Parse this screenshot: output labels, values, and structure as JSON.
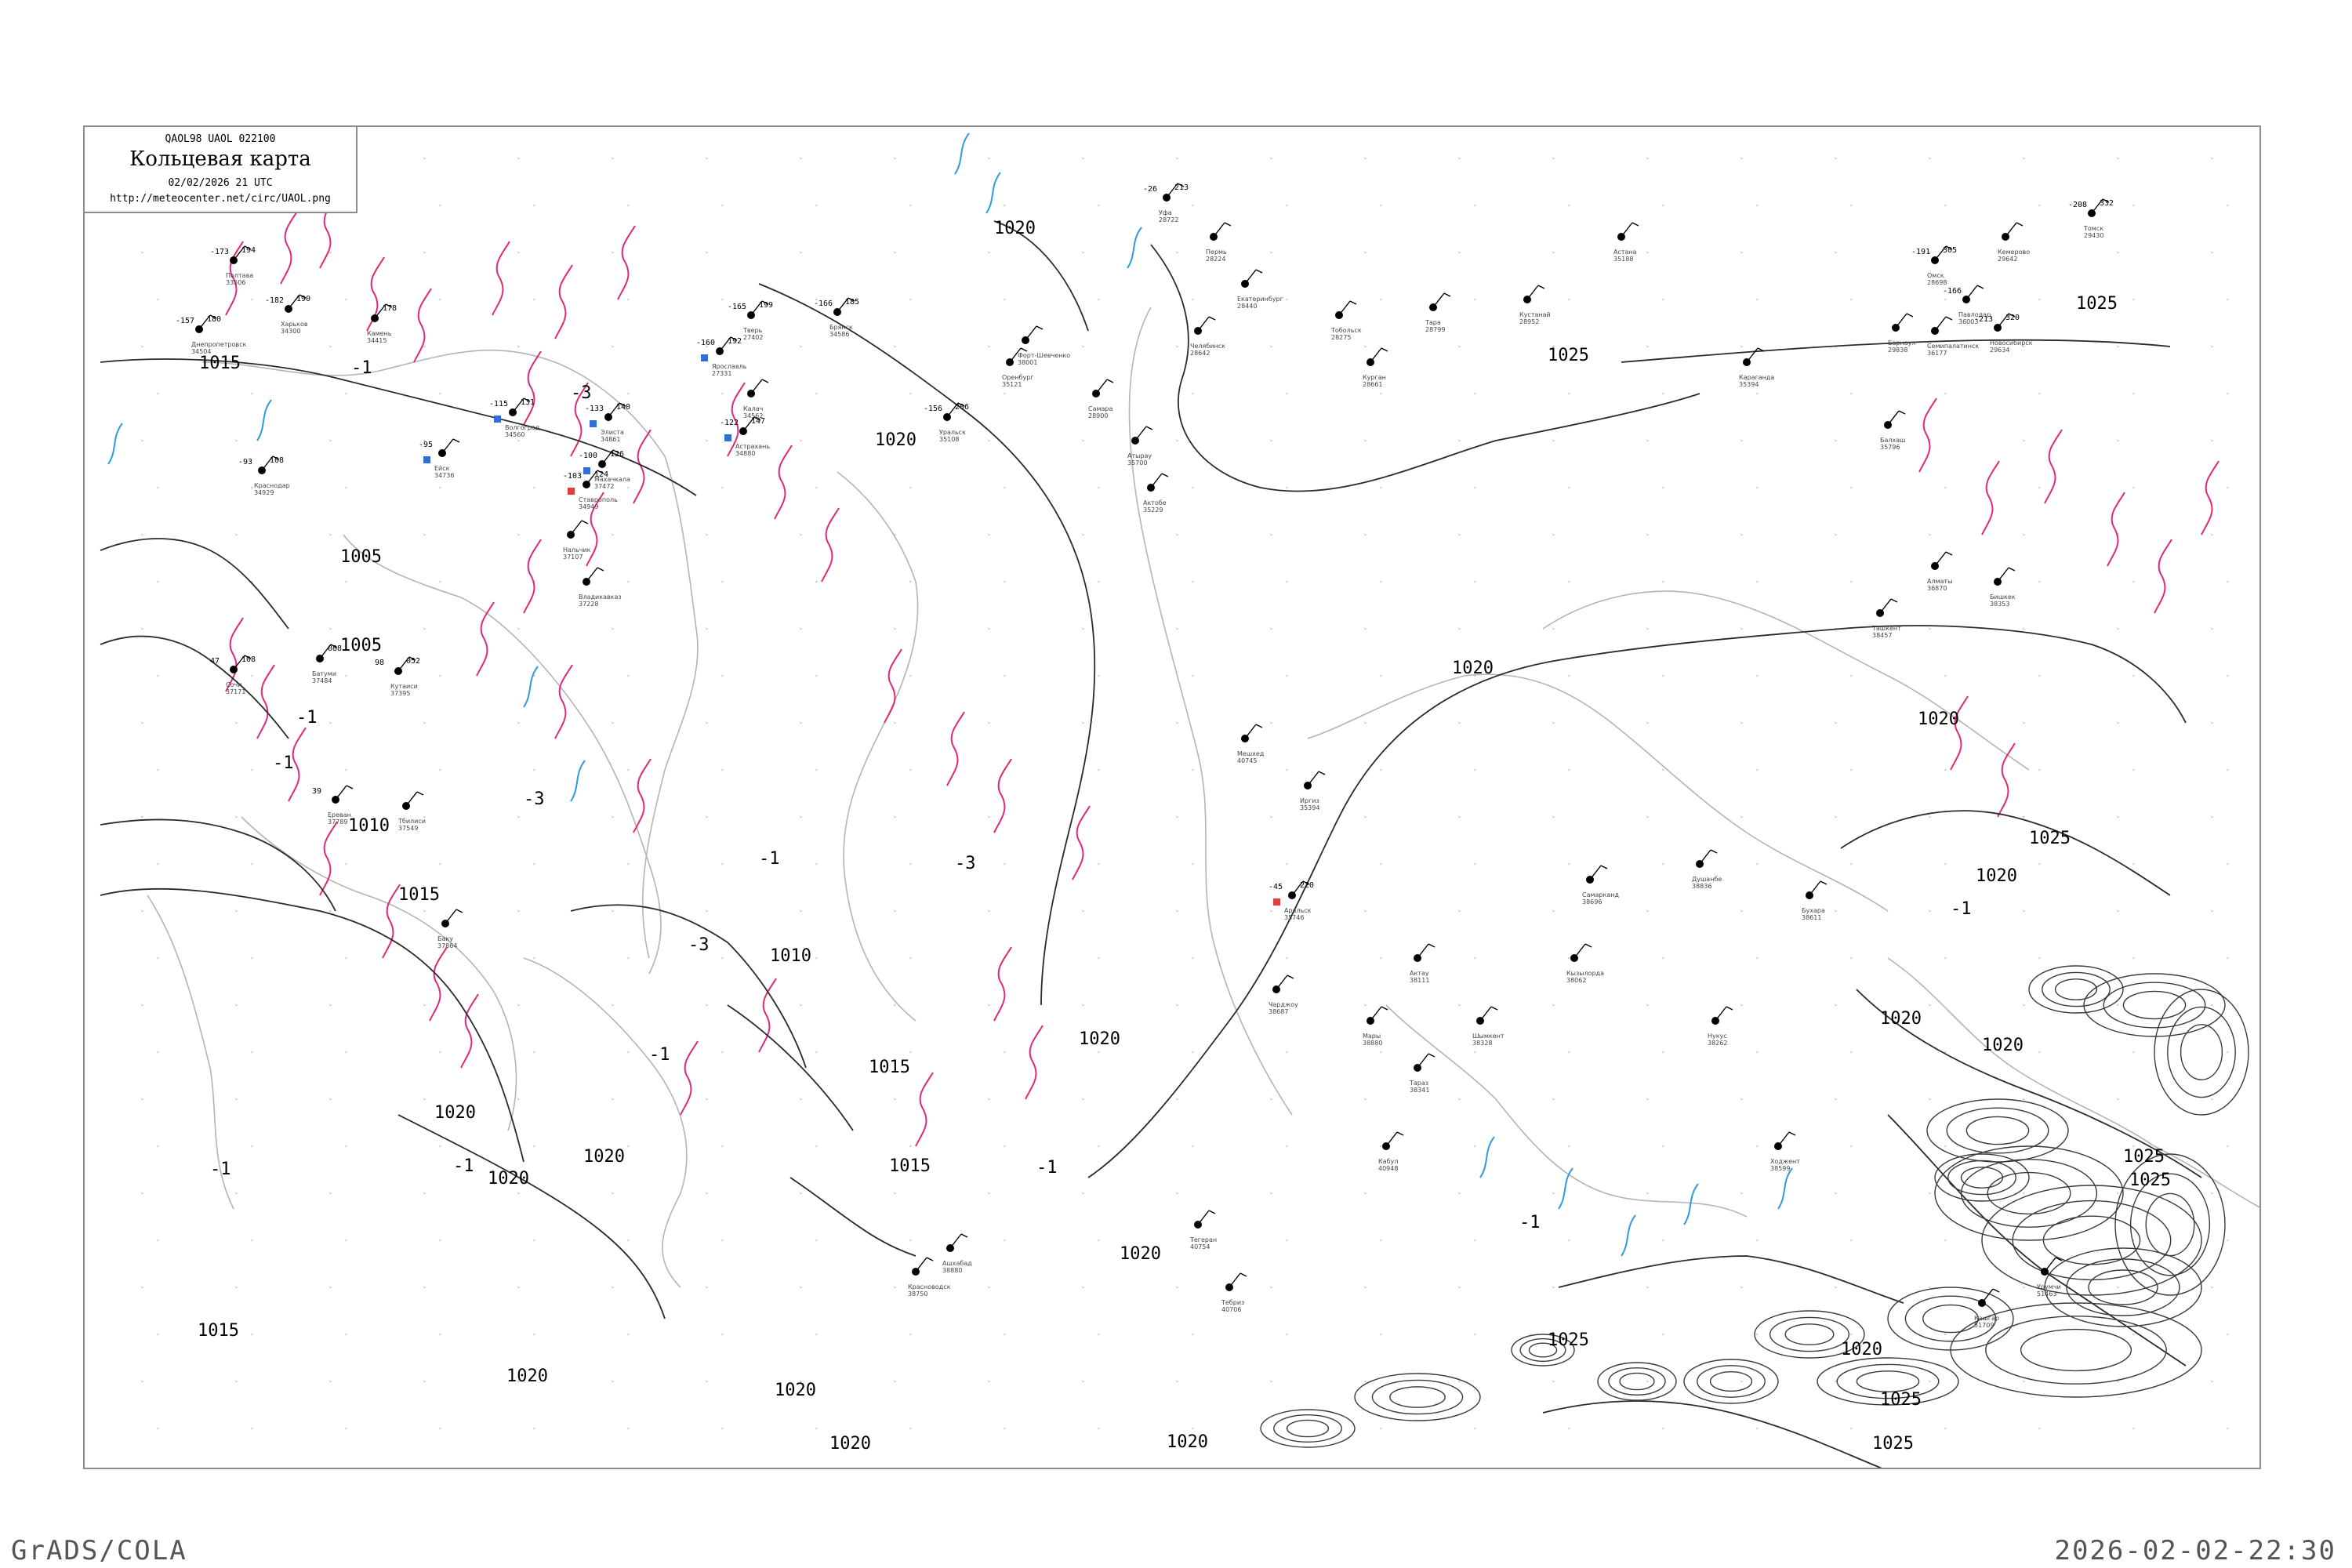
{
  "legend": {
    "code_line": "QAOL98  UAOL  022100",
    "title": "Кольцевая карта",
    "datetime": "02/02/2026 21 UTC",
    "url": "http://meteocenter.net/circ/UAOL.png"
  },
  "footer": {
    "left": "GrADS/COLA",
    "right": "2026-02-02-22:30"
  },
  "colors": {
    "coast": "#b4b4b4",
    "isobar": "#2a2a2a",
    "isotherm_neg": "#e0287a",
    "isotherm_pos": "#2d9be0",
    "marker_blue": "#2f6fd8",
    "marker_green": "#21a83a",
    "marker_red": "#e0403a",
    "marker_yellow": "#f0d22a"
  },
  "isobar_labels": [
    "1015",
    "1005",
    "1005",
    "1010",
    "1015",
    "1010",
    "1015",
    "1020",
    "1020",
    "1020",
    "1020",
    "1020",
    "1020",
    "1015",
    "1020",
    "1020",
    "1020",
    "1020",
    "1020",
    "1025",
    "1025",
    "1020",
    "1025",
    "1020",
    "1025",
    "1025",
    "1025",
    "1020",
    "1015",
    "1020",
    "1025",
    "1020",
    "1025",
    "1020"
  ],
  "isotherm_labels": [
    "-1",
    "-3",
    "-1",
    "-1",
    "-3",
    "-3",
    "-1",
    "-3",
    "-1",
    "-1",
    "-1",
    "-1",
    "-1",
    "-1"
  ],
  "stations": [
    {
      "name": "Полтава",
      "id": "33506",
      "t": "-173",
      "p": "194",
      "m": "none"
    },
    {
      "name": "Днепропетровск",
      "id": "34504",
      "t": "-157",
      "p": "180",
      "m": "none"
    },
    {
      "name": "Харьков",
      "id": "34300",
      "t": "-182",
      "p": "190",
      "m": "none"
    },
    {
      "name": "Камень",
      "id": "34415",
      "t": "",
      "p": "178",
      "m": "none"
    },
    {
      "name": "Тверь",
      "id": "27402",
      "t": "-165",
      "p": "199",
      "m": "none"
    },
    {
      "name": "Ярославль",
      "id": "27331",
      "t": "-160",
      "p": "192",
      "m": "blue"
    },
    {
      "name": "Калач",
      "id": "34562",
      "t": "",
      "p": "",
      "m": "none"
    },
    {
      "name": "Брянск",
      "id": "34586",
      "t": "-166",
      "p": "185",
      "m": "none"
    },
    {
      "name": "Ейск",
      "id": "34736",
      "t": "-95",
      "p": "",
      "m": "blue"
    },
    {
      "name": "Элиста",
      "id": "34861",
      "t": "-133",
      "p": "140",
      "m": "blue"
    },
    {
      "name": "Волгоград",
      "id": "34560",
      "t": "-115",
      "p": "131",
      "m": "blue"
    },
    {
      "name": "Астрахань",
      "id": "34880",
      "t": "-122",
      "p": "147",
      "m": "blue"
    },
    {
      "name": "Махачкала",
      "id": "37472",
      "t": "-100",
      "p": "126",
      "m": "blue"
    },
    {
      "name": "Ставрополь",
      "id": "34949",
      "t": "-103",
      "p": "124",
      "m": "red"
    },
    {
      "name": "Нальчик",
      "id": "37107",
      "t": "",
      "p": "",
      "m": "none"
    },
    {
      "name": "Владикавказ",
      "id": "37228",
      "t": "",
      "p": "",
      "m": "none"
    },
    {
      "name": "Краснодар",
      "id": "34929",
      "t": "-93",
      "p": "108",
      "m": "none"
    },
    {
      "name": "Сочи",
      "id": "37171",
      "t": "47",
      "p": "108",
      "m": "none"
    },
    {
      "name": "Батуми",
      "id": "37484",
      "t": "",
      "p": "088",
      "m": "none"
    },
    {
      "name": "Кутаиси",
      "id": "37395",
      "t": "98",
      "p": "052",
      "m": "none"
    },
    {
      "name": "Тбилиси",
      "id": "37549",
      "t": "",
      "p": "",
      "m": "none"
    },
    {
      "name": "Ереван",
      "id": "37789",
      "t": "39",
      "p": "",
      "m": "none"
    },
    {
      "name": "Баку",
      "id": "37864",
      "t": "",
      "p": "",
      "m": "none"
    },
    {
      "name": "Ашхабад",
      "id": "38880",
      "t": "",
      "p": "",
      "m": "none"
    },
    {
      "name": "Красноводск",
      "id": "38750",
      "t": "",
      "p": "",
      "m": "none"
    },
    {
      "name": "Форт-Шевченко",
      "id": "38001",
      "t": "",
      "p": "",
      "m": "none"
    },
    {
      "name": "Оренбург",
      "id": "35121",
      "t": "",
      "p": "",
      "m": "none"
    },
    {
      "name": "Уральск",
      "id": "35108",
      "t": "-156",
      "p": "206",
      "m": "none"
    },
    {
      "name": "Самара",
      "id": "28900",
      "t": "",
      "p": "",
      "m": "none"
    },
    {
      "name": "Атырау",
      "id": "35700",
      "t": "",
      "p": "",
      "m": "none"
    },
    {
      "name": "Актобе",
      "id": "35229",
      "t": "",
      "p": "",
      "m": "none"
    },
    {
      "name": "Уфа",
      "id": "28722",
      "t": "-26",
      "p": "213",
      "m": "none"
    },
    {
      "name": "Пермь",
      "id": "28224",
      "t": "",
      "p": "",
      "m": "none"
    },
    {
      "name": "Екатеринбург",
      "id": "28440",
      "t": "",
      "p": "",
      "m": "none"
    },
    {
      "name": "Челябинск",
      "id": "28642",
      "t": "",
      "p": "",
      "m": "none"
    },
    {
      "name": "Тобольск",
      "id": "28275",
      "t": "",
      "p": "",
      "m": "none"
    },
    {
      "name": "Курган",
      "id": "28661",
      "t": "",
      "p": "",
      "m": "none"
    },
    {
      "name": "Тара",
      "id": "28799",
      "t": "",
      "p": "",
      "m": "none"
    },
    {
      "name": "Кустанай",
      "id": "28952",
      "t": "",
      "p": "",
      "m": "none"
    },
    {
      "name": "Павлодар",
      "id": "36003",
      "t": "-166",
      "p": "",
      "m": "none"
    },
    {
      "name": "Семипалатинск",
      "id": "36177",
      "t": "",
      "p": "",
      "m": "none"
    },
    {
      "name": "Барнаул",
      "id": "29838",
      "t": "",
      "p": "",
      "m": "none"
    },
    {
      "name": "Новосибирск",
      "id": "29634",
      "t": "-213",
      "p": "320",
      "m": "none"
    },
    {
      "name": "Кемерово",
      "id": "29642",
      "t": "",
      "p": "",
      "m": "none"
    },
    {
      "name": "Томск",
      "id": "29430",
      "t": "-208",
      "p": "332",
      "m": "none"
    },
    {
      "name": "Омск",
      "id": "28698",
      "t": "-191",
      "p": "305",
      "m": "none"
    },
    {
      "name": "Караганда",
      "id": "35394",
      "t": "",
      "p": "",
      "m": "none"
    },
    {
      "name": "Астана",
      "id": "35188",
      "t": "",
      "p": "",
      "m": "none"
    },
    {
      "name": "Балхаш",
      "id": "35796",
      "t": "",
      "p": "",
      "m": "none"
    },
    {
      "name": "Алматы",
      "id": "36870",
      "t": "",
      "p": "",
      "m": "none"
    },
    {
      "name": "Бишкек",
      "id": "38353",
      "t": "",
      "p": "",
      "m": "none"
    },
    {
      "name": "Ташкент",
      "id": "38457",
      "t": "",
      "p": "",
      "m": "none"
    },
    {
      "name": "Самарканд",
      "id": "38696",
      "t": "",
      "p": "",
      "m": "none"
    },
    {
      "name": "Душанбе",
      "id": "38836",
      "t": "",
      "p": "",
      "m": "none"
    },
    {
      "name": "Бухара",
      "id": "38611",
      "t": "",
      "p": "",
      "m": "none"
    },
    {
      "name": "Нукус",
      "id": "38262",
      "t": "",
      "p": "",
      "m": "none"
    },
    {
      "name": "Кызылорда",
      "id": "38062",
      "t": "",
      "p": "",
      "m": "none"
    },
    {
      "name": "Шымкент",
      "id": "38328",
      "t": "",
      "p": "",
      "m": "none"
    },
    {
      "name": "Тараз",
      "id": "38341",
      "t": "",
      "p": "",
      "m": "none"
    },
    {
      "name": "Кабул",
      "id": "40948",
      "t": "",
      "p": "",
      "m": "none"
    },
    {
      "name": "Урумчи",
      "id": "51463",
      "t": "",
      "p": "",
      "m": "none"
    },
    {
      "name": "Кашгар",
      "id": "51709",
      "t": "",
      "p": "",
      "m": "none"
    },
    {
      "name": "Ходжент",
      "id": "38599",
      "t": "",
      "p": "",
      "m": "none"
    },
    {
      "name": "Аральск",
      "id": "35746",
      "t": "-45",
      "p": "220",
      "m": "red"
    },
    {
      "name": "Иргиз",
      "id": "35394",
      "t": "",
      "p": "",
      "m": "none"
    },
    {
      "name": "Чарджоу",
      "id": "38687",
      "t": "",
      "p": "",
      "m": "none"
    },
    {
      "name": "Мары",
      "id": "38880",
      "t": "",
      "p": "",
      "m": "none"
    },
    {
      "name": "Актау",
      "id": "38111",
      "t": "",
      "p": "",
      "m": "none"
    },
    {
      "name": "Мешхед",
      "id": "40745",
      "t": "",
      "p": "",
      "m": "none"
    },
    {
      "name": "Тебриз",
      "id": "40706",
      "t": "",
      "p": "",
      "m": "none"
    },
    {
      "name": "Тегеран",
      "id": "40754",
      "t": "",
      "p": "",
      "m": "none"
    }
  ]
}
